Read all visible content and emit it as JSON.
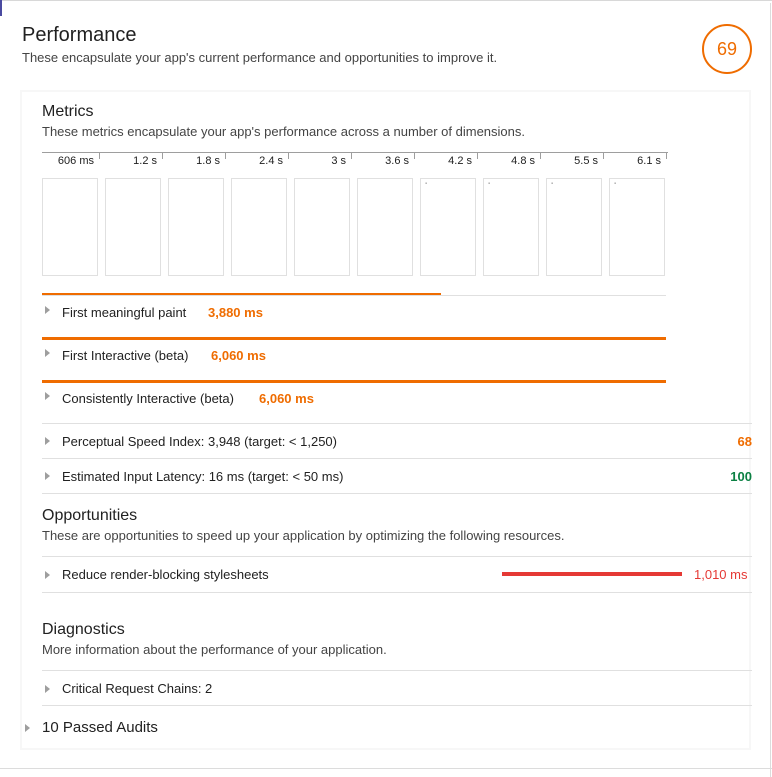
{
  "performance": {
    "title": "Performance",
    "subtitle": "These encapsulate your app's current performance and opportunities to improve it.",
    "score": "69",
    "score_color": "#ef6c00"
  },
  "metrics": {
    "title": "Metrics",
    "subtitle": "These metrics encapsulate your app's performance across a number of dimensions.",
    "timeline_ticks": [
      "606 ms",
      "1.2 s",
      "1.8 s",
      "2.4 s",
      "3 s",
      "3.6 s",
      "4.2 s",
      "4.8 s",
      "5.5 s",
      "6.1 s"
    ],
    "items": [
      {
        "label": "First meaningful paint",
        "value": "3,880 ms",
        "fraction": 0.64
      },
      {
        "label": "First Interactive (beta)",
        "value": "6,060 ms",
        "fraction": 1.0
      },
      {
        "label": "Consistently Interactive (beta)",
        "value": "6,060 ms",
        "fraction": 1.0
      }
    ],
    "accent": "#ef6c00"
  },
  "audits": [
    {
      "label": "Perceptual Speed Index: 3,948 (target: < 1,250)",
      "score": "68",
      "color": "#ef6c00"
    },
    {
      "label": "Estimated Input Latency: 16 ms (target: < 50 ms)",
      "score": "100",
      "color": "#0b8043"
    }
  ],
  "opportunities": {
    "title": "Opportunities",
    "subtitle": "These are opportunities to speed up your application by optimizing the following resources.",
    "items": [
      {
        "label": "Reduce render-blocking stylesheets",
        "value": "1,010 ms",
        "color": "#e53935"
      }
    ]
  },
  "diagnostics": {
    "title": "Diagnostics",
    "subtitle": "More information about the performance of your application.",
    "items": [
      {
        "label": "Critical Request Chains: 2"
      }
    ]
  },
  "passed": {
    "label": "10 Passed Audits"
  }
}
